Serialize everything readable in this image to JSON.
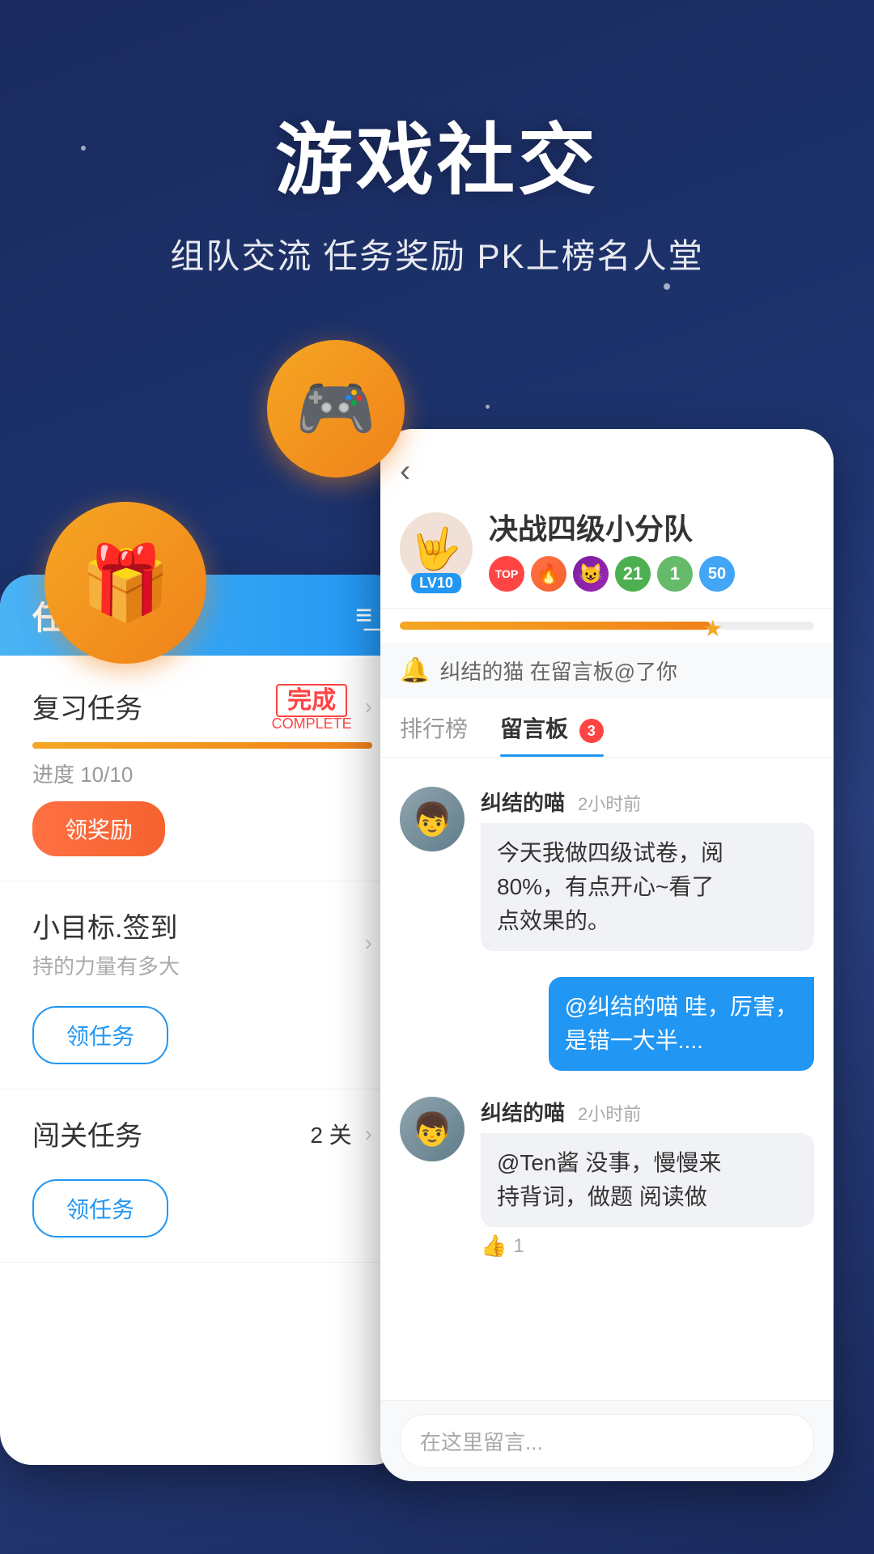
{
  "background": {
    "color_top": "#1a2a5e",
    "color_bottom": "#2a4080"
  },
  "header": {
    "main_title": "游戏社交",
    "sub_title": "组队交流 任务奖励 PK上榜名人堂"
  },
  "left_phone": {
    "title": "任务",
    "filter_icon": "≡",
    "tasks": [
      {
        "name": "复习任务",
        "status": "完成",
        "status_sub": "COMPLETE",
        "progress_text": "进度 10/10",
        "progress_pct": 100,
        "btn_label": "领奖励",
        "btn_type": "filled"
      },
      {
        "name": "小目标.签到",
        "sub": "持的力量有多大",
        "btn_label": "领任务",
        "btn_type": "outline"
      },
      {
        "name": "闯关任务",
        "count": "2 关",
        "btn_label": "领任务",
        "btn_type": "outline"
      }
    ]
  },
  "right_phone": {
    "back_label": "‹",
    "group_name": "决战四级小分队",
    "avatar_emoji": "🤟",
    "lv_label": "LV10",
    "badge_top_label": "TOP",
    "badge_numbers": [
      "21",
      "1",
      "50"
    ],
    "notification_text": "纠结的猫 在留言板@了你",
    "tabs": [
      {
        "label": "排行榜",
        "active": false
      },
      {
        "label": "留言板",
        "active": true,
        "badge": 3
      }
    ],
    "messages": [
      {
        "sender": "纠结的喵",
        "time": "2小时前",
        "text": "今天我做四级试卷，阅\n80%，有点开心~看了\n点效果的。",
        "self": false,
        "avatar": "👦"
      },
      {
        "sender": "self",
        "text": "@纠结的喵 哇，厉害，\n是错一大半....",
        "self": true
      },
      {
        "sender": "纠结的喵",
        "time": "2小时前",
        "text": "@Ten酱 没事，慢慢来\n持背词，做题 阅读做",
        "self": false,
        "avatar": "👦",
        "like_count": "1"
      }
    ],
    "input_placeholder": "在这里留言...",
    "exp_pct": 75
  },
  "icons": {
    "gift": "🎁",
    "gamepad": "🎮",
    "bell": "🔔",
    "back": "‹",
    "chevron_right": "›"
  }
}
